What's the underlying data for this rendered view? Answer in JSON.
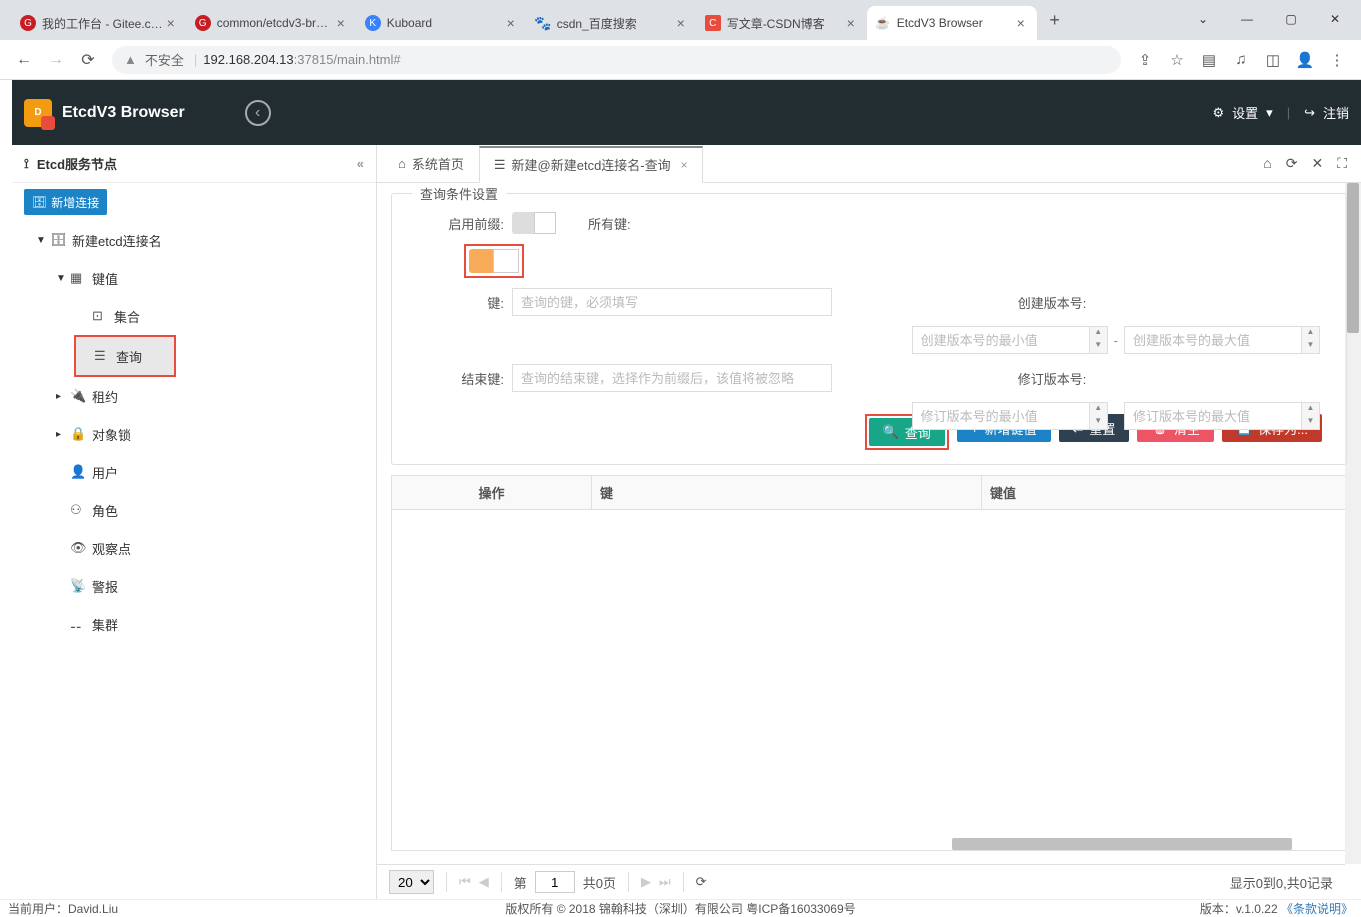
{
  "browser": {
    "tabs": [
      {
        "title": "我的工作台 - Gitee.c…",
        "favicon": "G",
        "favcolor": "#c71d24"
      },
      {
        "title": "common/etcdv3-br…",
        "favicon": "G",
        "favcolor": "#c71d24"
      },
      {
        "title": "Kuboard",
        "favicon": "K",
        "favcolor": "#3b82f6"
      },
      {
        "title": "csdn_百度搜索",
        "favicon": "",
        "favcolor": "#2932e1"
      },
      {
        "title": "写文章-CSDN博客",
        "favicon": "C",
        "favcolor": "#e74c3c"
      },
      {
        "title": "EtcdV3 Browser",
        "favicon": "",
        "favcolor": "#888",
        "active": true
      }
    ],
    "address": {
      "insecure": "不安全",
      "host": "192.168.204.13",
      "port": ":37815",
      "path": "/main.html#"
    }
  },
  "header": {
    "brand": "EtcdV3 Browser",
    "settings": "设置",
    "logout": "注销"
  },
  "sidebar": {
    "title": "Etcd服务节点",
    "add": "新增连接",
    "conn": "新建etcd连接名",
    "items": {
      "kv": "键值",
      "col": "集合",
      "query": "查询",
      "lease": "租约",
      "lock": "对象锁",
      "user": "用户",
      "role": "角色",
      "watch": "观察点",
      "alarm": "警报",
      "cluster": "集群"
    }
  },
  "maintabs": {
    "home": "系统首页",
    "current": "新建@新建etcd连接名-查询"
  },
  "form": {
    "legend": "查询条件设置",
    "enablePrefix": "启用前缀:",
    "allKeys": "所有键:",
    "key": "键:",
    "keyPh": "查询的键，必须填写",
    "endKey": "结束键:",
    "endKeyPh": "查询的结束键，选择作为前缀后，该值将被忽略",
    "createRev": "创建版本号:",
    "createMinPh": "创建版本号的最小值",
    "createMaxPh": "创建版本号的最大值",
    "modRev": "修订版本号:",
    "modMinPh": "修订版本号的最小值",
    "modMaxPh": "修订版本号的最大值",
    "btns": {
      "query": "查询",
      "add": "新增键值",
      "reset": "重置",
      "clear": "清空",
      "save": "保存为..."
    }
  },
  "table": {
    "op": "操作",
    "key": "键",
    "val": "键值"
  },
  "pager": {
    "size": "20",
    "page": "1",
    "pre": "第",
    "total": "共0页",
    "summary": "显示0到0,共0记录"
  },
  "footer": {
    "user": "当前用户：David.Liu",
    "copyright": "版权所有 © 2018 锦翰科技（深圳）有限公司 粤ICP备16033069号",
    "version": "版本：v.1.0.22 ",
    "terms": "《条款说明》"
  }
}
